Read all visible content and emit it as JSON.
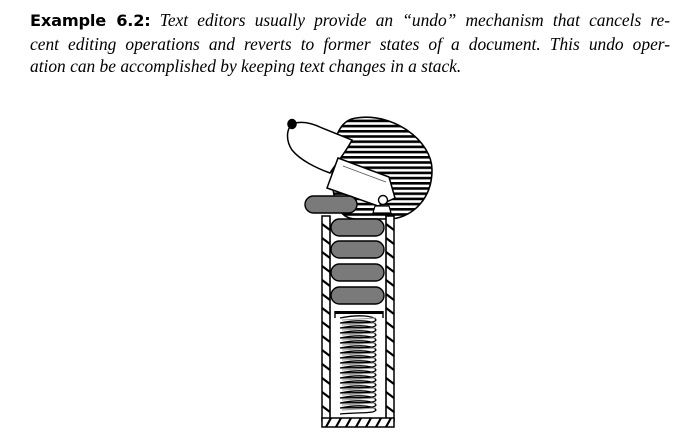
{
  "example": {
    "label": "Example 6.2:",
    "lines": [
      "Text editors usually provide an “undo” mechanism that cancels re-",
      "cent editing operations and reverts to former states of a document. This undo oper-",
      "ation can be accomplished by keeping text changes in a stack."
    ]
  },
  "figure": {
    "stack_item_count": 4,
    "popped_item_count": 1,
    "colors": {
      "item_fill": "#7a7a7a",
      "ink": "#000000",
      "paper": "#ffffff",
      "hatch_gray": "#9a9a9a"
    }
  }
}
